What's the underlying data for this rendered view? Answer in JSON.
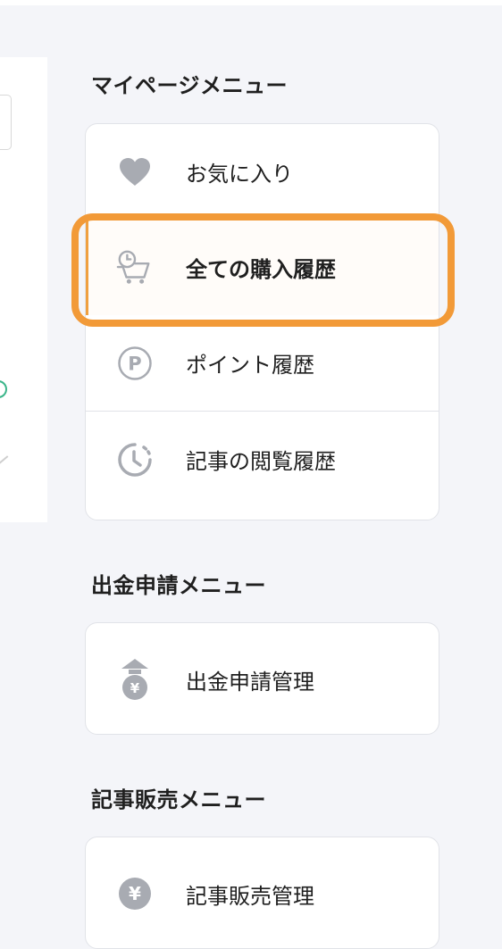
{
  "mypage_menu": {
    "title": "マイページメニュー",
    "items": [
      {
        "label": "お気に入り",
        "icon": "heart-icon"
      },
      {
        "label": "全ての購入履歴",
        "icon": "cart-clock-icon",
        "active": true
      },
      {
        "label": "ポイント履歴",
        "icon": "point-p-icon"
      },
      {
        "label": "記事の閲覧履歴",
        "icon": "history-clock-icon"
      }
    ]
  },
  "withdraw_menu": {
    "title": "出金申請メニュー",
    "items": [
      {
        "label": "出金申請管理",
        "icon": "yen-withdraw-icon"
      }
    ]
  },
  "sales_menu": {
    "title": "記事販売メニュー",
    "items": [
      {
        "label": "記事販売管理",
        "icon": "yen-coin-icon"
      }
    ]
  },
  "colors": {
    "highlight": "#f29a38",
    "icon_gray": "#a8abb2",
    "background": "#f4f5f9"
  }
}
